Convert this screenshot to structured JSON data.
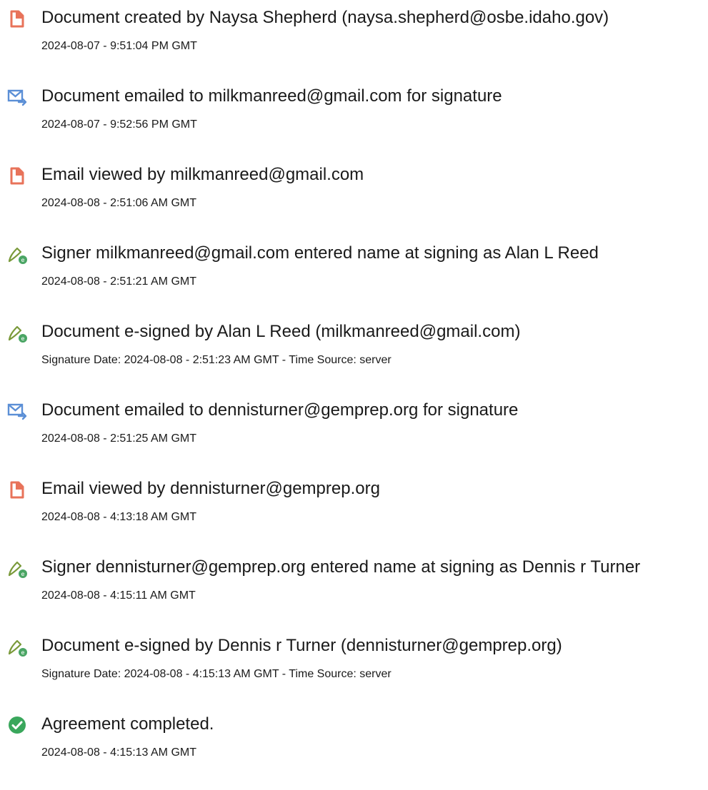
{
  "events": [
    {
      "icon": "document-icon",
      "title": "Document created by Naysa Shepherd (naysa.shepherd@osbe.idaho.gov)",
      "time": "2024-08-07 - 9:51:04 PM GMT"
    },
    {
      "icon": "email-sent-icon",
      "title": "Document emailed to milkmanreed@gmail.com for signature",
      "time": "2024-08-07 - 9:52:56 PM GMT"
    },
    {
      "icon": "document-icon",
      "title": "Email viewed by milkmanreed@gmail.com",
      "time": "2024-08-08 - 2:51:06 AM GMT"
    },
    {
      "icon": "e-sign-pen-icon",
      "title": "Signer milkmanreed@gmail.com entered name at signing as Alan L Reed",
      "time": "2024-08-08 - 2:51:21 AM GMT"
    },
    {
      "icon": "e-sign-pen-icon",
      "title": "Document e-signed by Alan L Reed (milkmanreed@gmail.com)",
      "time": "Signature Date: 2024-08-08 - 2:51:23 AM GMT - Time Source: server"
    },
    {
      "icon": "email-sent-icon",
      "title": "Document emailed to dennisturner@gemprep.org for signature",
      "time": "2024-08-08 - 2:51:25 AM GMT"
    },
    {
      "icon": "document-icon",
      "title": "Email viewed by dennisturner@gemprep.org",
      "time": "2024-08-08 - 4:13:18 AM GMT"
    },
    {
      "icon": "e-sign-pen-icon",
      "title": "Signer dennisturner@gemprep.org entered name at signing as Dennis r Turner",
      "time": "2024-08-08 - 4:15:11 AM GMT"
    },
    {
      "icon": "e-sign-pen-icon",
      "title": "Document e-signed by Dennis r Turner (dennisturner@gemprep.org)",
      "time": "Signature Date: 2024-08-08 - 4:15:13 AM GMT - Time Source: server"
    },
    {
      "icon": "checkmark-circle-icon",
      "title": "Agreement completed.",
      "time": "2024-08-08 - 4:15:13 AM GMT"
    }
  ],
  "colors": {
    "document_icon": "#e8735a",
    "email_icon": "#5b8fd6",
    "pen_icon": "#7a9a3a",
    "pen_badge": "#4aa564",
    "check_icon": "#3aa75c"
  }
}
